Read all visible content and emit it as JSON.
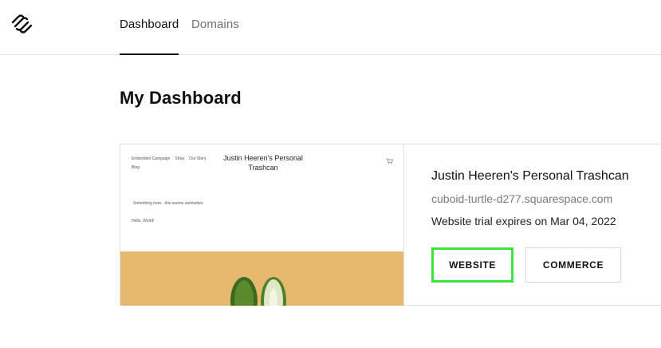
{
  "header": {
    "logo": "squarespace-logo",
    "tabs": [
      {
        "label": "Dashboard",
        "active": true
      },
      {
        "label": "Domains",
        "active": false
      }
    ]
  },
  "main": {
    "title": "My Dashboard",
    "site": {
      "preview": {
        "nav_items": [
          "Embedded Campaign",
          "Shop",
          "Our Story"
        ],
        "blog_link": "Blog",
        "title": "Justin Heeren's Personal Trashcan",
        "body_text": "Something here.. this seems unintuitive.",
        "hello_text": "Hello, World!",
        "cart_icon": "cart-icon",
        "hero_color": "#e6b96f"
      },
      "name": "Justin Heeren's Personal Trashcan",
      "domain": "cuboid-turtle-d277.squarespace.com",
      "trial_text": "Website trial expires on Mar 04, 2022",
      "buttons": {
        "website": "WEBSITE",
        "commerce": "COMMERCE"
      }
    }
  },
  "colors": {
    "highlight": "#3be63b",
    "border": "#e0e0e0",
    "muted_text": "#7a7a7a"
  }
}
